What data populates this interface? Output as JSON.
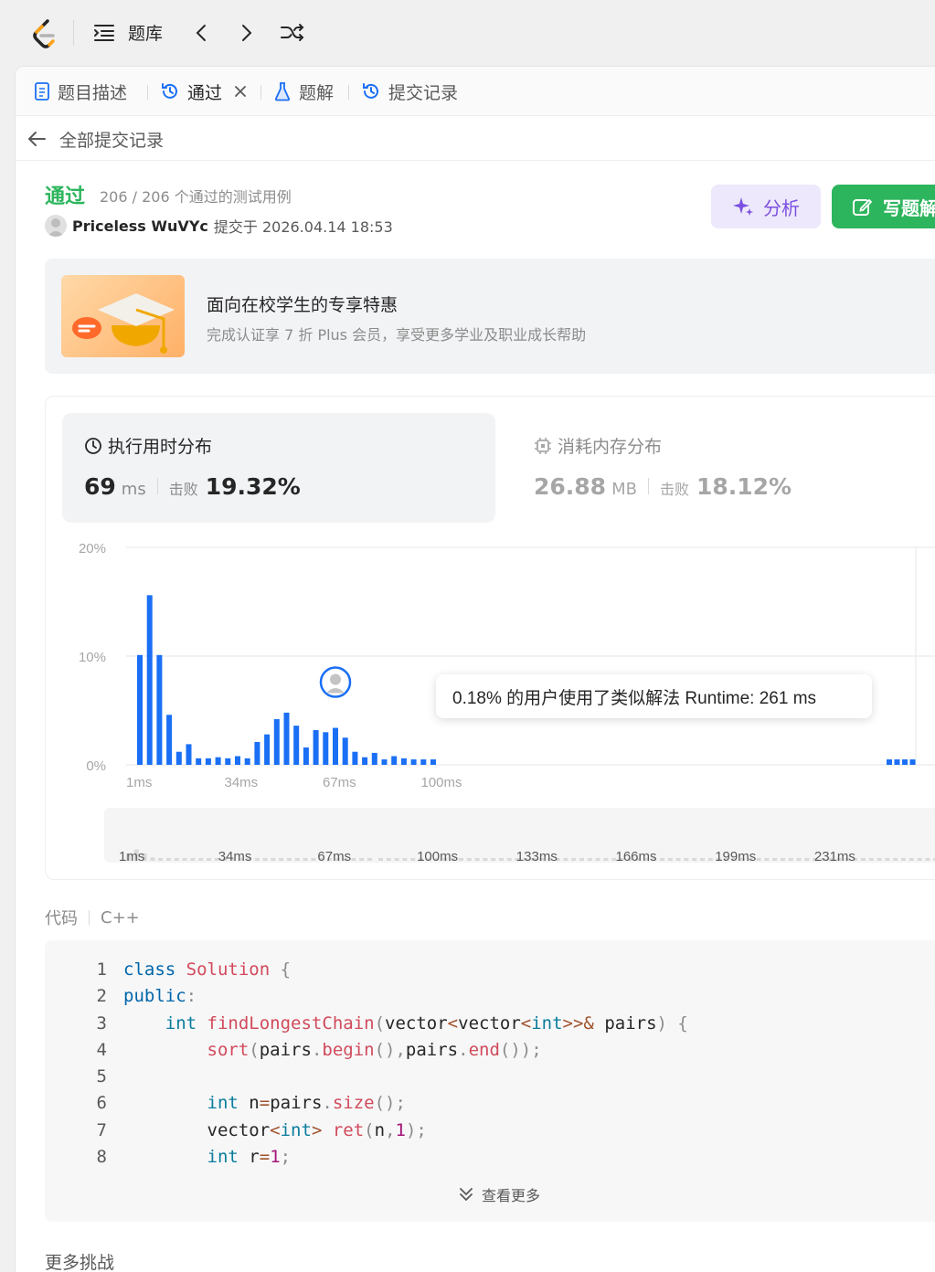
{
  "topbar": {
    "problemset_label": "题库"
  },
  "tabs": [
    {
      "label": "题目描述",
      "icon": "document-icon"
    },
    {
      "label": "通过",
      "icon": "history-icon",
      "active": true,
      "closable": true
    },
    {
      "label": "题解",
      "icon": "flask-icon"
    },
    {
      "label": "提交记录",
      "icon": "history-icon"
    }
  ],
  "back": {
    "label": "全部提交记录"
  },
  "submission": {
    "status": "通过",
    "cases": "206 / 206 个通过的测试用例",
    "username": "Priceless WuVYc",
    "submitted_at": "提交于 2026.04.14 18:53"
  },
  "actions": {
    "analyze_label": "分析",
    "write_label": "写题解"
  },
  "promo": {
    "title": "面向在校学生的专享特惠",
    "subtitle": "完成认证享 7 折 Plus 会员，享受更多学业及职业成长帮助"
  },
  "runtime": {
    "title": "执行用时分布",
    "value": "69",
    "unit": "ms",
    "beat_label": "击败",
    "beat_pct": "19.32%"
  },
  "memory": {
    "title": "消耗内存分布",
    "value": "26.88",
    "unit": "MB",
    "beat_label": "击败",
    "beat_pct": "18.12%"
  },
  "chart_data": {
    "type": "bar",
    "y_ticks": [
      "20%",
      "10%",
      "0%"
    ],
    "ylim": [
      0,
      20
    ],
    "x_ticks": [
      "1ms",
      "34ms",
      "67ms",
      "100ms"
    ],
    "brush_ticks": [
      "1ms",
      "34ms",
      "67ms",
      "100ms",
      "133ms",
      "166ms",
      "199ms",
      "231ms"
    ],
    "values": [
      10.1,
      15.6,
      10.1,
      4.6,
      1.2,
      1.9,
      0.6,
      0.6,
      0.7,
      0.6,
      0.8,
      0.6,
      2.1,
      2.8,
      4.2,
      4.8,
      3.6,
      1.6,
      3.2,
      3.0,
      3.4,
      2.5,
      1.2,
      0.7,
      1.1,
      0.5,
      0.8,
      0.6,
      0.5,
      0.5,
      0.5
    ],
    "tail_value": 0.5,
    "highlight_index": 20,
    "colors": {
      "bar": "#1a6ff5",
      "grid": "#e6e6e6"
    }
  },
  "tooltip": {
    "text": "0.18% 的用户使用了类似解法 Runtime: 261 ms"
  },
  "code": {
    "label": "代码",
    "language": "C++",
    "more_label": "查看更多"
  },
  "more_challenges": "更多挑战"
}
